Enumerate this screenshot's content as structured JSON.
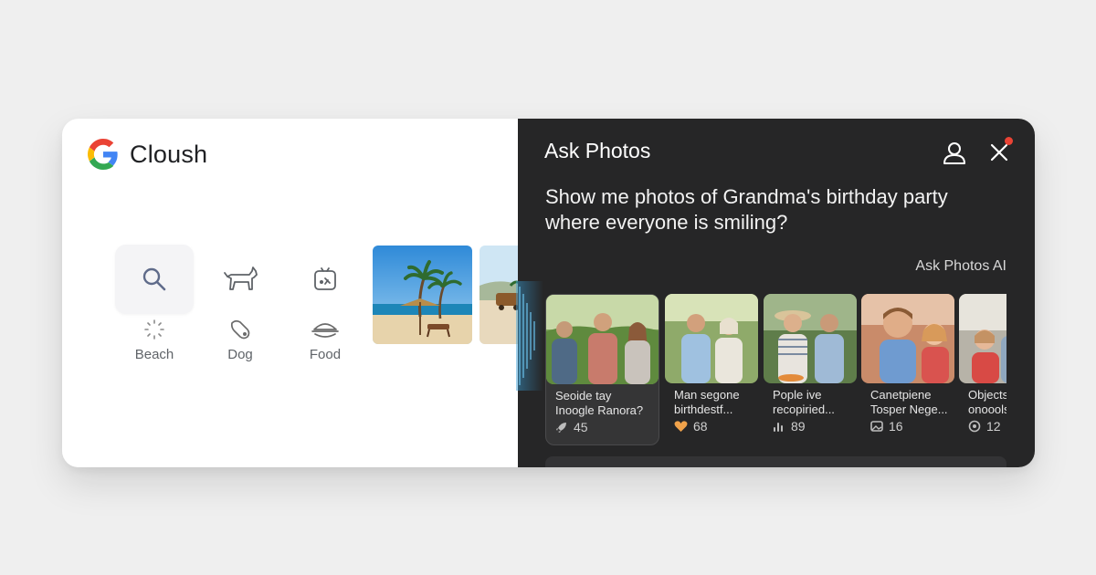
{
  "left_panel": {
    "brand": {
      "title": "Cloush",
      "logo_icon": "google-g-logo"
    },
    "categories": [
      {
        "label": "Beach",
        "icon": "search-icon",
        "sub_icon": "loading-spinner-icon",
        "active": true
      },
      {
        "label": "Dog",
        "icon": "dog-icon",
        "sub_icon": "dog-head-icon",
        "active": false
      },
      {
        "label": "Food",
        "icon": "food-tile-icon",
        "sub_icon": "food-dish-icon",
        "active": false
      }
    ],
    "thumbnails": [
      {
        "name": "beach-palm-photo"
      },
      {
        "name": "beach-cart-photo"
      }
    ]
  },
  "ask_panel": {
    "title": "Ask Photos",
    "query": "Show me photos of Grandma's birthday party where everyone is smiling?",
    "ai_label": "Ask Photos AI",
    "icons": {
      "account": "account-icon",
      "close": "close-icon"
    },
    "notification_color": "#ea4335",
    "results": [
      {
        "caption": "Seoide tay\nInoogle Ranora?",
        "meta_icon": "rocket-icon",
        "count": "45",
        "selected": true
      },
      {
        "caption": "Man segone\nbirthdestf...",
        "meta_icon": "heart-icon",
        "count": "68",
        "selected": false
      },
      {
        "caption": "Pople ive\nrecopiried...",
        "meta_icon": "chart-icon",
        "count": "89",
        "selected": false
      },
      {
        "caption": "Canetpiene\nTosper Nege...",
        "meta_icon": "photo-icon",
        "count": "16",
        "selected": false
      },
      {
        "caption": "Objects\nonoools",
        "meta_icon": "settings-icon",
        "count": "12",
        "selected": false
      }
    ]
  },
  "colors": {
    "dark_panel": "#262627",
    "light_panel": "#ffffff",
    "accent_blue": "#4285f4",
    "accent_red": "#ea4335",
    "accent_yellow": "#fbbc05",
    "accent_green": "#34a853"
  }
}
